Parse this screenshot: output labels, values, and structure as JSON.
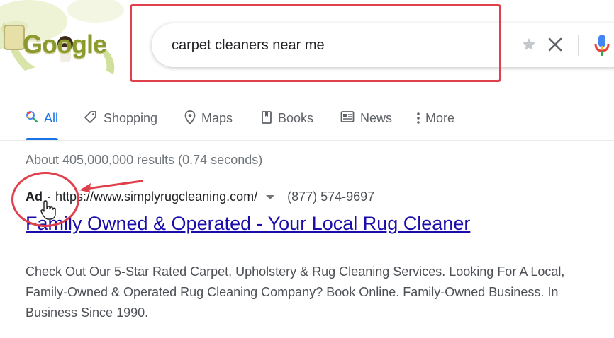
{
  "logo": {
    "text": "Google"
  },
  "search": {
    "query": "carpet cleaners near me",
    "star_icon": "star-icon",
    "clear_icon": "close-icon",
    "mic_icon": "mic-icon"
  },
  "tabs": [
    {
      "label": "All",
      "icon": "search-icon",
      "active": true
    },
    {
      "label": "Shopping",
      "icon": "tag-icon"
    },
    {
      "label": "Maps",
      "icon": "map-pin-icon"
    },
    {
      "label": "Books",
      "icon": "book-icon"
    },
    {
      "label": "News",
      "icon": "news-icon"
    },
    {
      "label": "More",
      "icon": "more-vert-icon"
    }
  ],
  "result_stats": "About 405,000,000 results (0.74 seconds)",
  "ad": {
    "label": "Ad",
    "separator": "·",
    "url": "https://www.simplyrugcleaning.com/",
    "phone": "(877) 574-9697",
    "title": "Family Owned & Operated - Your Local Rug Cleaner",
    "description": "Check Out Our 5-Star Rated Carpet, Upholstery & Rug Cleaning Services. Looking For A Local, Family-Owned & Operated Rug Cleaning Company? Book Online. Family-Owned Business. In Business Since 1990."
  },
  "colors": {
    "link": "#1a0dab",
    "accent": "#1a73e8",
    "annotation": "#e0404b"
  }
}
